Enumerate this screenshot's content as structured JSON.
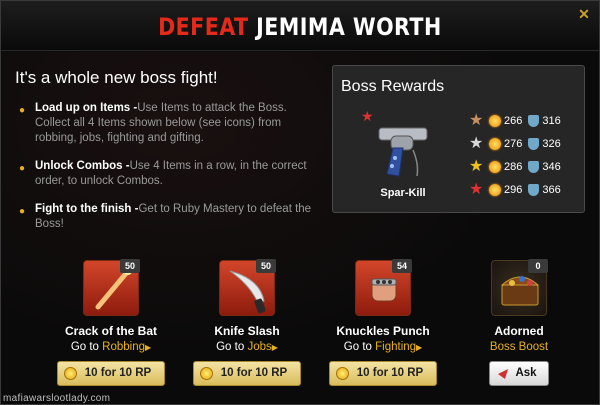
{
  "header": {
    "title_red": "DEFEAT",
    "title_white": "JEMIMA WORTH",
    "close_label": "✕"
  },
  "intro": {
    "subtitle": "It's a whole new boss fight!",
    "bullets": [
      {
        "lead": "Load up on Items -",
        "text": "Use Items to attack the Boss. Collect all 4 Items shown below (see icons) from robbing, jobs, fighting and gifting."
      },
      {
        "lead": "Unlock Combos -",
        "text": "Use 4 Items in a row, in the correct order, to unlock Combos."
      },
      {
        "lead": "Fight to the finish -",
        "text": "Get to Ruby Mastery to defeat the Boss!"
      }
    ]
  },
  "rewards": {
    "title": "Boss Rewards",
    "item_name": "Spar-Kill",
    "tiers": [
      {
        "star_color": "#c89060",
        "attack": "266",
        "defense": "316"
      },
      {
        "star_color": "#d8d8d8",
        "attack": "276",
        "defense": "326"
      },
      {
        "star_color": "#f0c020",
        "attack": "286",
        "defense": "346"
      },
      {
        "star_color": "#e03030",
        "attack": "296",
        "defense": "366"
      }
    ]
  },
  "items": [
    {
      "name": "Crack of the Bat",
      "count": "50",
      "goto": "Go to",
      "link": "Robbing",
      "button": "10 for 10 RP",
      "icon": "bat-icon"
    },
    {
      "name": "Knife Slash",
      "count": "50",
      "goto": "Go to",
      "link": "Jobs",
      "button": "10 for 10 RP",
      "icon": "knife-icon"
    },
    {
      "name": "Knuckles Punch",
      "count": "54",
      "goto": "Go to",
      "link": "Fighting",
      "button": "10 for 10 RP",
      "icon": "brass-knuckles-icon"
    },
    {
      "name": "Adorned",
      "count": "0",
      "goto": "",
      "link": "Boss Boost",
      "button": "Ask",
      "icon": "treasure-chest-icon"
    }
  ],
  "watermark": "mafiawarslootlady.com",
  "colors": {
    "accent_red": "#e52a1a",
    "link_gold": "#e8b020",
    "button_gold": "#d9bd5c"
  }
}
